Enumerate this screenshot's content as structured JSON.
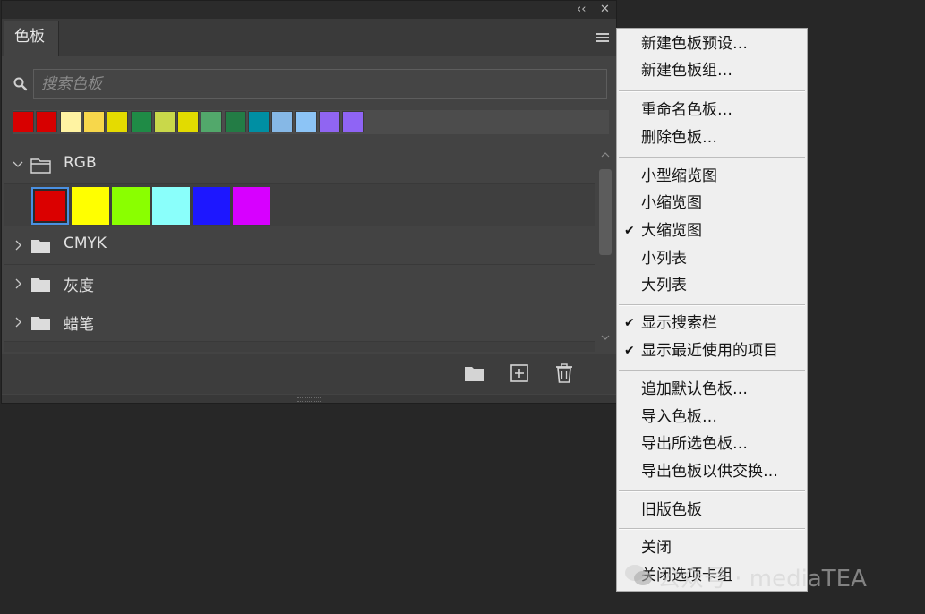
{
  "panel": {
    "collapse_glyph": "‹‹",
    "close_glyph": "✕",
    "tab_label": "色板",
    "search_placeholder": "搜索色板",
    "recent_swatches": [
      "#d80000",
      "#d70000",
      "#fff3a2",
      "#f7d74b",
      "#e5db00",
      "#1f8b46",
      "#c9d84a",
      "#e2db00",
      "#52a86b",
      "#237c45",
      "#008fa3",
      "#86b8e6",
      "#8cc4f6",
      "#9065f2",
      "#8f64f5"
    ],
    "groups": [
      {
        "label": "RGB",
        "expanded": true,
        "swatches": [
          "#db0000",
          "#ffff00",
          "#8aff00",
          "#8afffb",
          "#1d17ff",
          "#d700ff"
        ],
        "selected_index": 0
      },
      {
        "label": "CMYK",
        "expanded": false
      },
      {
        "label": "灰度",
        "expanded": false
      },
      {
        "label": "蜡笔",
        "expanded": false
      }
    ],
    "bottom_buttons": [
      "folder-icon",
      "new-swatch-icon",
      "trash-icon"
    ]
  },
  "menu": {
    "items": [
      {
        "label": "新建色板预设…",
        "checked": false
      },
      {
        "label": "新建色板组…",
        "checked": false
      },
      {
        "label": "重命名色板…",
        "checked": false
      },
      {
        "label": "删除色板…",
        "checked": false
      },
      {
        "label": "小型缩览图",
        "checked": false
      },
      {
        "label": "小缩览图",
        "checked": false
      },
      {
        "label": "大缩览图",
        "checked": true
      },
      {
        "label": "小列表",
        "checked": false
      },
      {
        "label": "大列表",
        "checked": false
      },
      {
        "label": "显示搜索栏",
        "checked": true
      },
      {
        "label": "显示最近使用的项目",
        "checked": true
      },
      {
        "label": "追加默认色板…",
        "checked": false
      },
      {
        "label": "导入色板…",
        "checked": false
      },
      {
        "label": "导出所选色板…",
        "checked": false
      },
      {
        "label": "导出色板以供交换…",
        "checked": false
      },
      {
        "label": "旧版色板",
        "checked": false
      },
      {
        "label": "关闭",
        "checked": false
      },
      {
        "label": "关闭选项卡组",
        "checked": false
      }
    ],
    "check_glyph": "✔"
  },
  "watermark": {
    "text": "公众号 · mediaTEA"
  }
}
